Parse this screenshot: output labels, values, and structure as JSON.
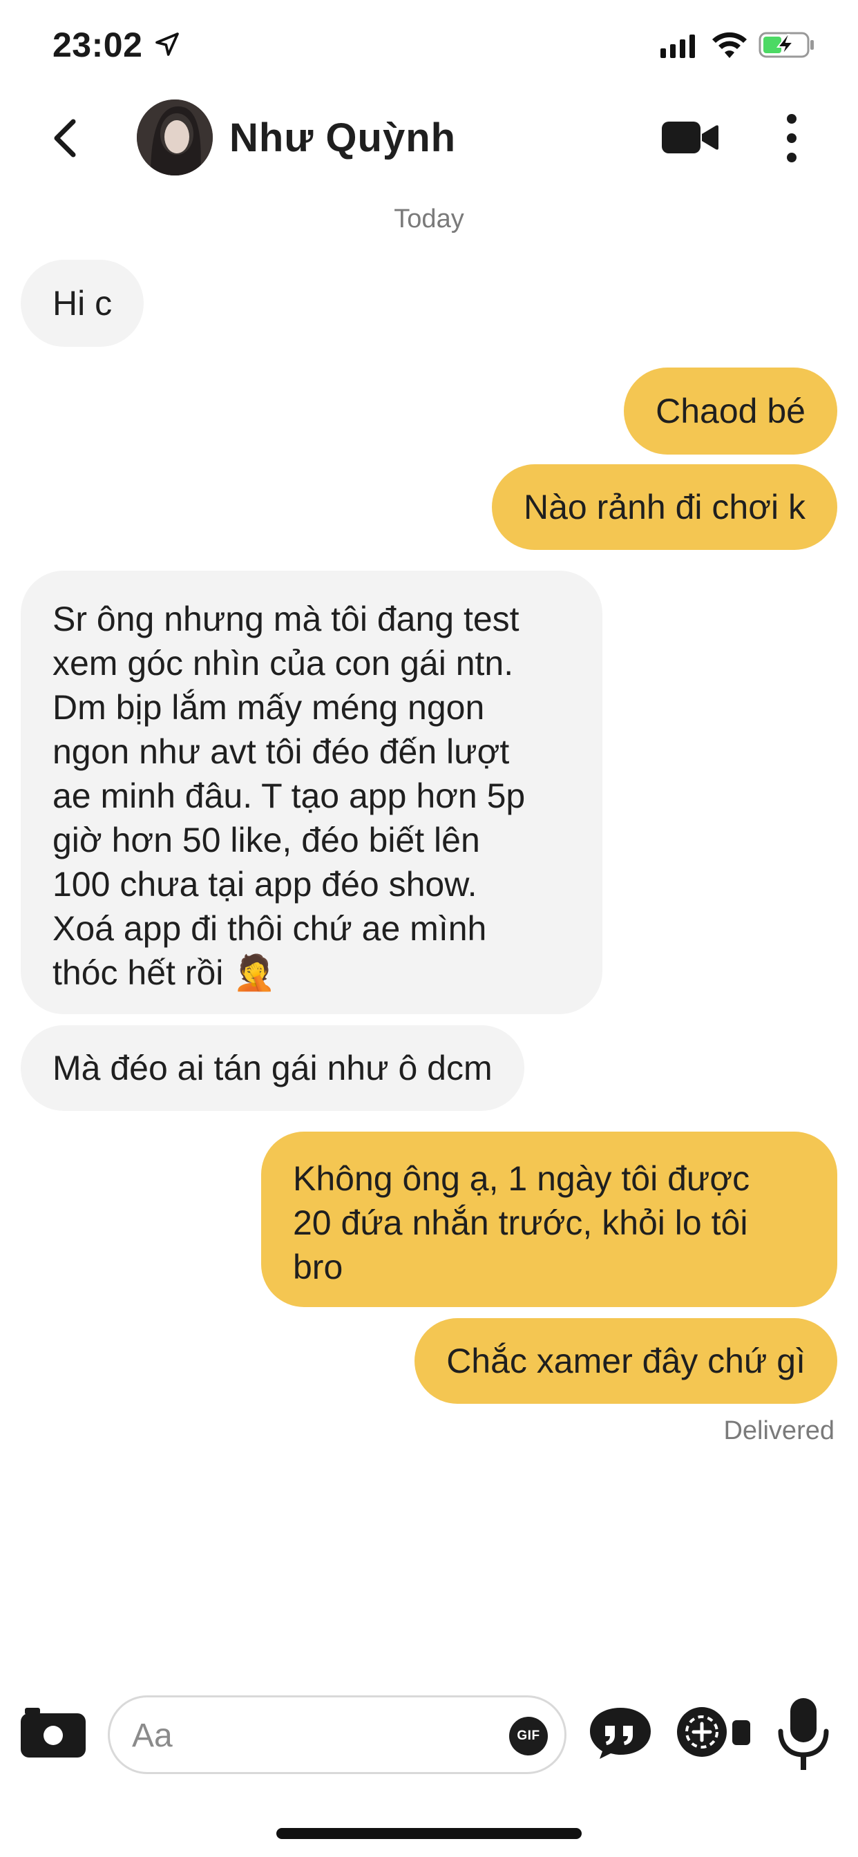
{
  "status_bar": {
    "time": "23:02",
    "icons": [
      "location-arrow-icon",
      "cellular-signal-icon",
      "wifi-icon",
      "battery-charging-icon"
    ],
    "battery_color": "#4cd964"
  },
  "header": {
    "contact_name": "Như Quỳnh",
    "icons": [
      "back-chevron-icon",
      "video-camera-icon",
      "more-vertical-icon"
    ]
  },
  "conversation": {
    "date_label": "Today",
    "messages": [
      {
        "direction": "incoming",
        "lines": [
          "Hi c"
        ]
      },
      {
        "direction": "outgoing",
        "lines": [
          "Chaod bé"
        ]
      },
      {
        "direction": "outgoing",
        "lines": [
          "Nào rảnh đi chơi k"
        ]
      },
      {
        "direction": "incoming",
        "lines": [
          "Sr ông nhưng mà tôi đang test",
          "xem góc nhìn của con gái ntn.",
          "Dm bịp lắm mấy méng ngon",
          "ngon như avt tôi đéo đến lượt",
          "ae minh đâu. T tạo app hơn 5p",
          "giờ hơn 50 like, đéo biết lên",
          "100 chưa tại app đéo show.",
          "Xoá app đi thôi chứ ae mình",
          "thóc hết rồi 🤦"
        ]
      },
      {
        "direction": "incoming",
        "lines": [
          "Mà đéo ai tán gái như ô dcm"
        ]
      },
      {
        "direction": "outgoing",
        "lines": [
          "Không ông ạ, 1 ngày tôi được",
          "20 đứa nhắn trước, khỏi lo tôi",
          "bro"
        ]
      },
      {
        "direction": "outgoing",
        "lines": [
          "Chắc xamer đây chứ gì"
        ]
      }
    ],
    "status": "Delivered"
  },
  "composer": {
    "placeholder": "Aa",
    "gif_label": "GIF",
    "icons": [
      "camera-icon",
      "quote-icon",
      "sticker-video-icon",
      "microphone-icon"
    ]
  },
  "colors": {
    "outgoing_bubble": "#f4c652",
    "incoming_bubble": "#f3f3f3",
    "secondary_text": "#7a7a7a"
  }
}
